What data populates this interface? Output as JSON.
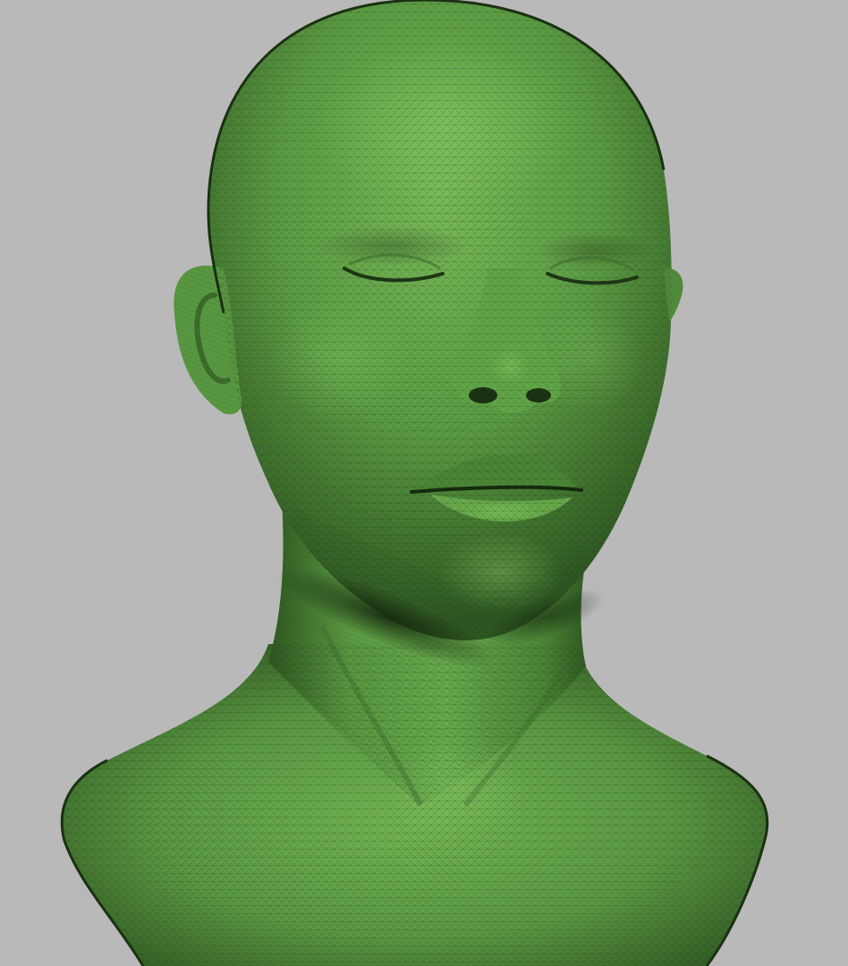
{
  "scene": {
    "background_color": "#b9b9b9",
    "mesh_base_color": "#5b9a42",
    "mesh_highlight_color": "#7fc25f",
    "mesh_shadow_color": "#274a1c",
    "wire_color": "#1c3314",
    "subject": "head-bust-mesh"
  }
}
